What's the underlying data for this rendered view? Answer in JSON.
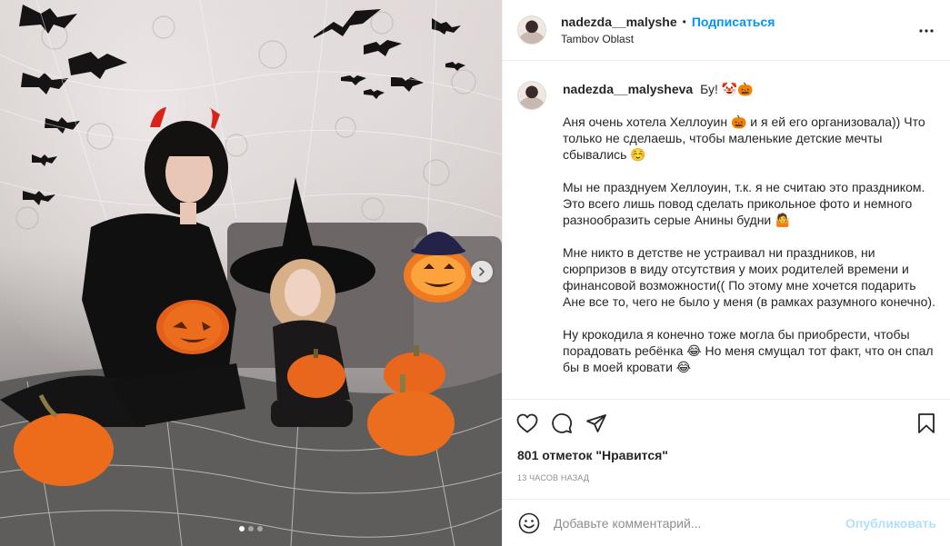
{
  "post": {
    "author": "nadezda__malyshe",
    "separator": "•",
    "follow_label": "Подписаться",
    "location": "Tambov Oblast"
  },
  "caption": {
    "author": "nadezda__malysheva",
    "title": "Бу! 🤡🎃",
    "paragraphs": [
      "Аня очень хотела Хеллоуин 🎃 и я ей его организовала)) Что только не сделаешь, чтобы маленькие детские мечты сбывались ☺️",
      "Мы не празднуем Хеллоуин, т.к. я не считаю это праздником. Это всего лишь повод сделать прикольное фото и немного разнообразить серые Анины будни 🤷",
      "Мне никто в детстве не устраивал ни праздников, ни сюрпризов в виду отсутствия у моих родителей времени и финансовой возможности(( По этому мне хочется подарить Ане все то, чего не было у меня (в рамках разумного конечно).",
      "Ну крокодила я конечно тоже могла бы приобрести, чтобы порадовать ребёнка 😂 Но меня смущал тот факт, что он спал бы в моей кровати 😂"
    ]
  },
  "engagement": {
    "likes": "801 отметок \"Нравится\"",
    "timestamp": "13 часов назад"
  },
  "comment_box": {
    "placeholder": "Добавьте комментарий...",
    "post_label": "Опубликовать"
  },
  "carousel": {
    "total_slides": 3,
    "active_slide": 1
  },
  "icons": {
    "more": "more-options-icon",
    "like": "heart-icon",
    "comment": "comment-icon",
    "share": "share-icon",
    "save": "bookmark-icon",
    "emoji": "emoji-icon",
    "next": "chevron-right-icon"
  },
  "colors": {
    "follow": "#0095f6",
    "post_disabled": "#b2dffc",
    "secondary_text": "#8e8e8e",
    "border": "#efefef"
  }
}
